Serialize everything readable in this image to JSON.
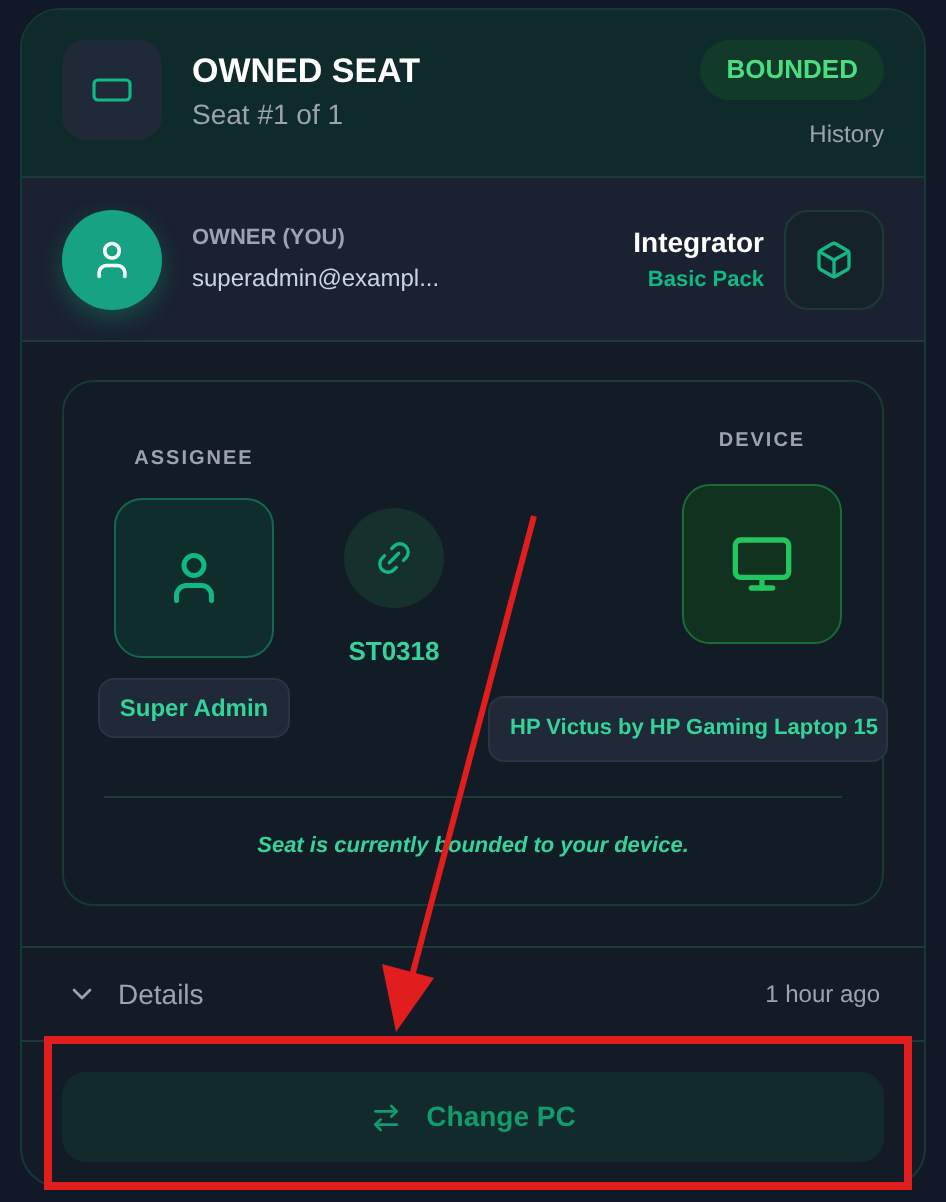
{
  "header": {
    "title": "OWNED SEAT",
    "subtitle": "Seat #1 of 1",
    "status": "BOUNDED",
    "history_link": "History"
  },
  "owner": {
    "label": "OWNER (YOU)",
    "email": "superadmin@exampl...",
    "plan": "Integrator",
    "pack": "Basic Pack"
  },
  "binding": {
    "assignee_label": "ASSIGNEE",
    "assignee_name": "Super Admin",
    "seat_code": "ST0318",
    "device_label": "DEVICE",
    "device_name": "HP Victus by HP Gaming Laptop 15",
    "note": "Seat is currently bounded to your device."
  },
  "details": {
    "label": "Details",
    "expanded": false,
    "time": "1 hour ago"
  },
  "action_button": "Change PC"
}
